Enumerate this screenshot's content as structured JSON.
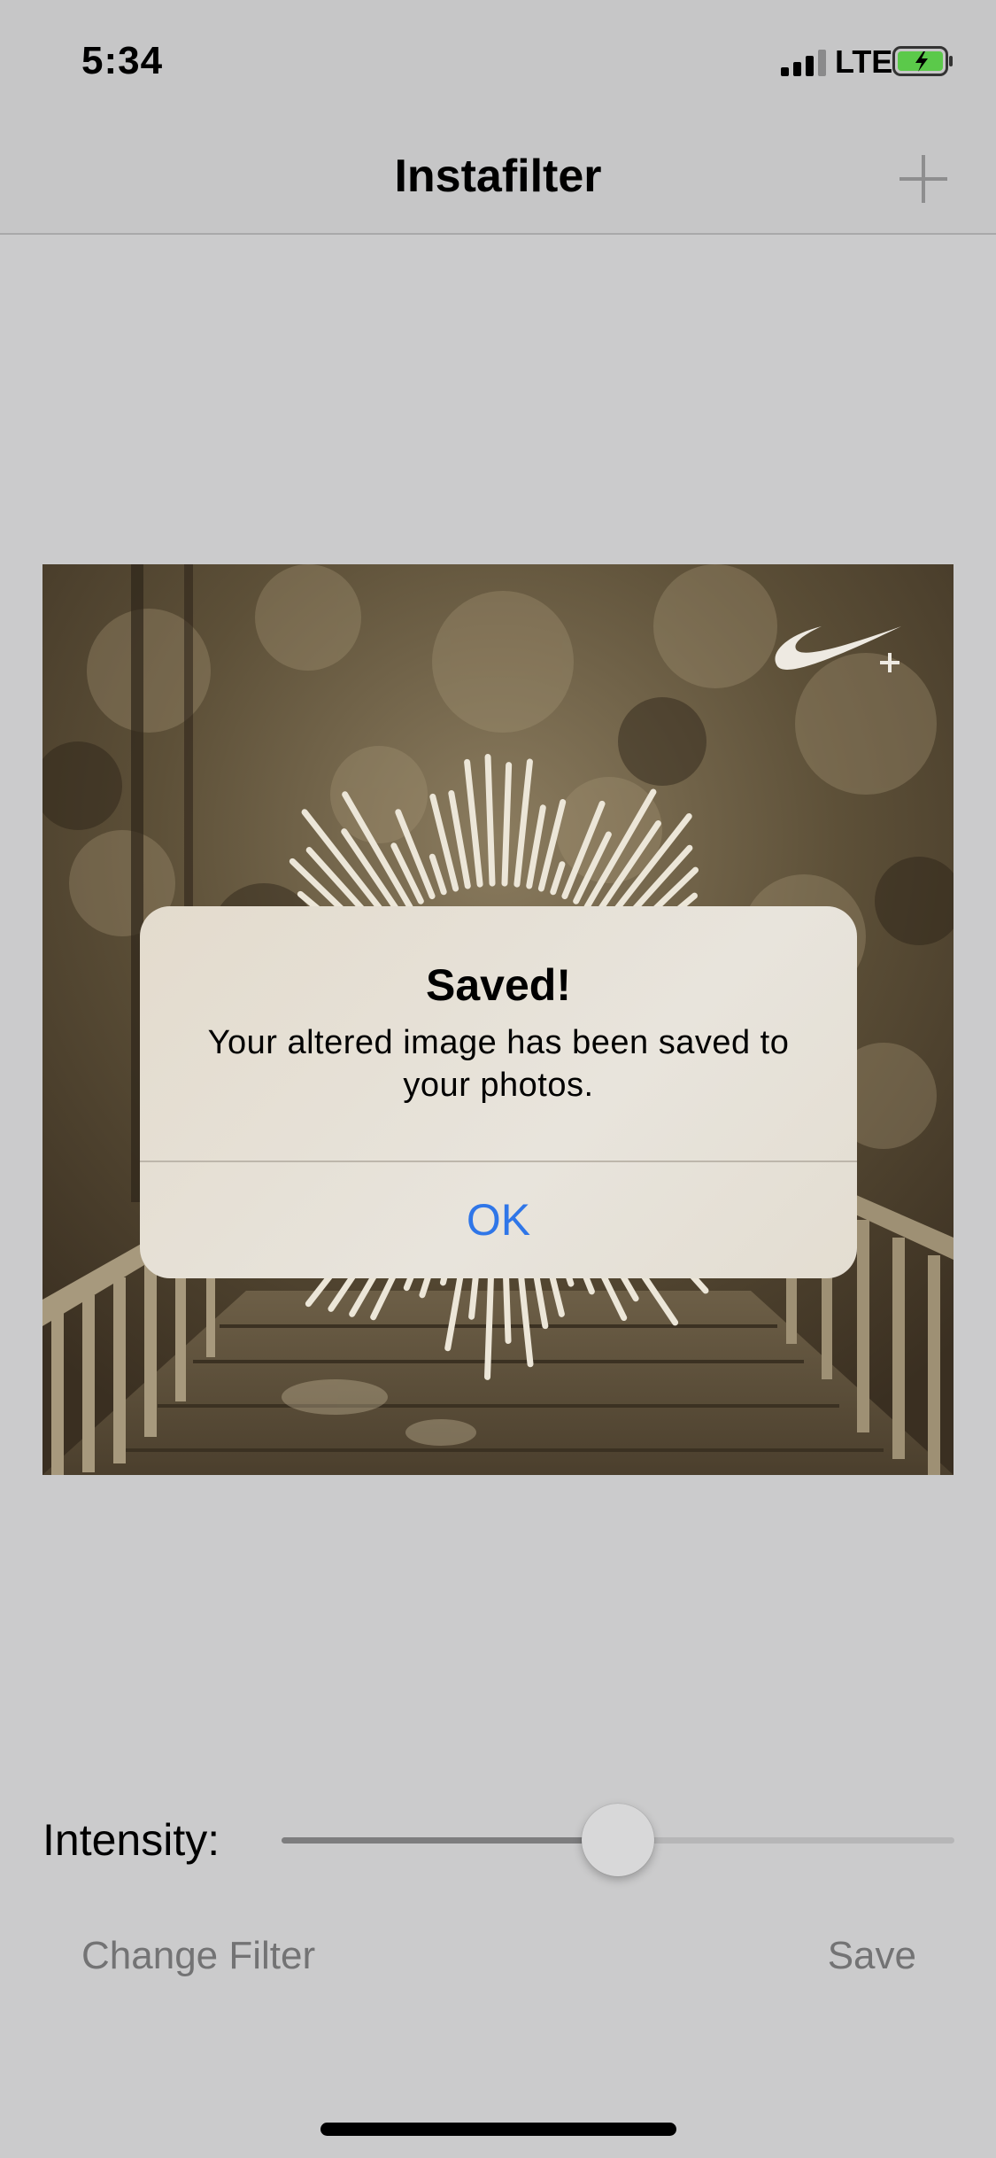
{
  "status_bar": {
    "time": "5:34",
    "network": "LTE",
    "icons": [
      "signal-icon",
      "battery-charging-icon"
    ]
  },
  "nav_bar": {
    "title": "Instafilter",
    "add_icon": "plus-icon"
  },
  "image": {
    "description_icon": "sepia-photo",
    "logo_icon": "swoosh-logo-icon"
  },
  "alert": {
    "title": "Saved!",
    "message": "Your altered image has been saved to your photos.",
    "ok_label": "OK"
  },
  "controls": {
    "intensity_label": "Intensity:",
    "intensity_value": 0.5,
    "change_filter_label": "Change Filter",
    "save_label": "Save"
  },
  "colors": {
    "accent": "#2f76e8",
    "background": "#cbcbcc",
    "sepia_dark": "#3d3324",
    "sepia_light": "#a89a7c"
  }
}
